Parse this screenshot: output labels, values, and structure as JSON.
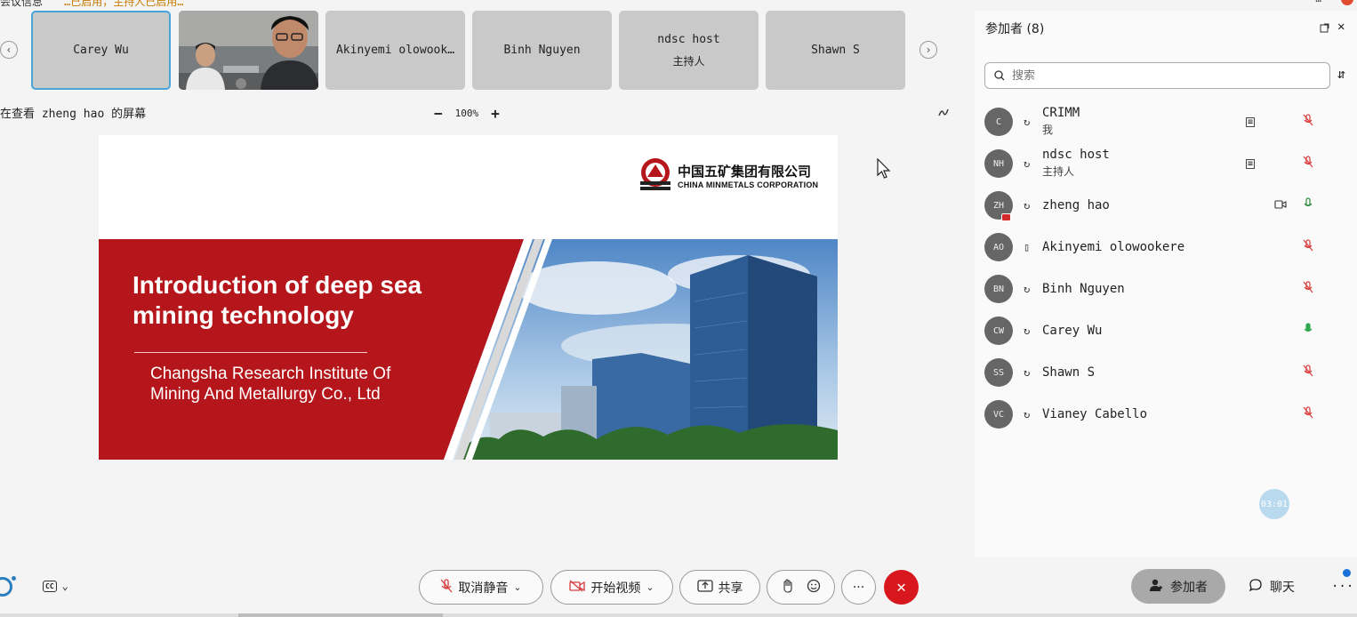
{
  "topbar": {
    "meeting_info": "会议信息",
    "notice": "…已启用，主持人已启用…",
    "time": "…"
  },
  "video_strip": {
    "prev": "‹",
    "next": "›",
    "tiles": [
      {
        "name": "Carey Wu",
        "role": ""
      },
      {
        "name": "",
        "role": ""
      },
      {
        "name": "Akinyemi olowook…",
        "role": ""
      },
      {
        "name": "Binh Nguyen",
        "role": ""
      },
      {
        "name": "ndsc host",
        "role": "主持人"
      },
      {
        "name": "Shawn S",
        "role": ""
      }
    ]
  },
  "share": {
    "viewing_label": "在查看 zheng hao 的屏幕",
    "zoom_out": "−",
    "zoom_level": "100%",
    "zoom_in": "+"
  },
  "slide": {
    "logo_cn": "中国五矿集团有限公司",
    "logo_en": "CHINA MINMETALS CORPORATION",
    "title": "Introduction of deep sea mining technology",
    "org": "Changsha Research Institute Of Mining And Metallurgy Co., Ltd"
  },
  "participants": {
    "title": "参加者 (8)",
    "search_placeholder": "搜索",
    "items": [
      {
        "initials": "C",
        "name": "CRIMM",
        "role": "我",
        "cc": true,
        "cam": false,
        "mic": "muted"
      },
      {
        "initials": "NH",
        "name": "ndsc host",
        "role": "主持人",
        "cc": true,
        "cam": false,
        "mic": "muted"
      },
      {
        "initials": "ZH",
        "name": "zheng hao",
        "role": "",
        "cc": false,
        "cam": true,
        "mic": "on"
      },
      {
        "initials": "AO",
        "name": "Akinyemi olowookere",
        "role": "",
        "cc": false,
        "cam": false,
        "mic": "muted"
      },
      {
        "initials": "BN",
        "name": "Binh Nguyen",
        "role": "",
        "cc": false,
        "cam": false,
        "mic": "muted"
      },
      {
        "initials": "CW",
        "name": "Carey Wu",
        "role": "",
        "cc": false,
        "cam": false,
        "mic": "talk"
      },
      {
        "initials": "SS",
        "name": "Shawn S",
        "role": "",
        "cc": false,
        "cam": false,
        "mic": "muted"
      },
      {
        "initials": "VC",
        "name": "Vianey Cabello",
        "role": "",
        "cc": false,
        "cam": false,
        "mic": "muted"
      }
    ],
    "timer": "03:01"
  },
  "toolbar": {
    "unmute": "取消静音",
    "start_video": "开始视频",
    "share": "共享",
    "more": "···",
    "participants": "参加者",
    "chat": "聊天",
    "overflow": "···"
  },
  "colors": {
    "accent": "#2a7fbf",
    "end": "#d8161d",
    "banner": "#b5161b",
    "muted": "#d93a3a"
  }
}
